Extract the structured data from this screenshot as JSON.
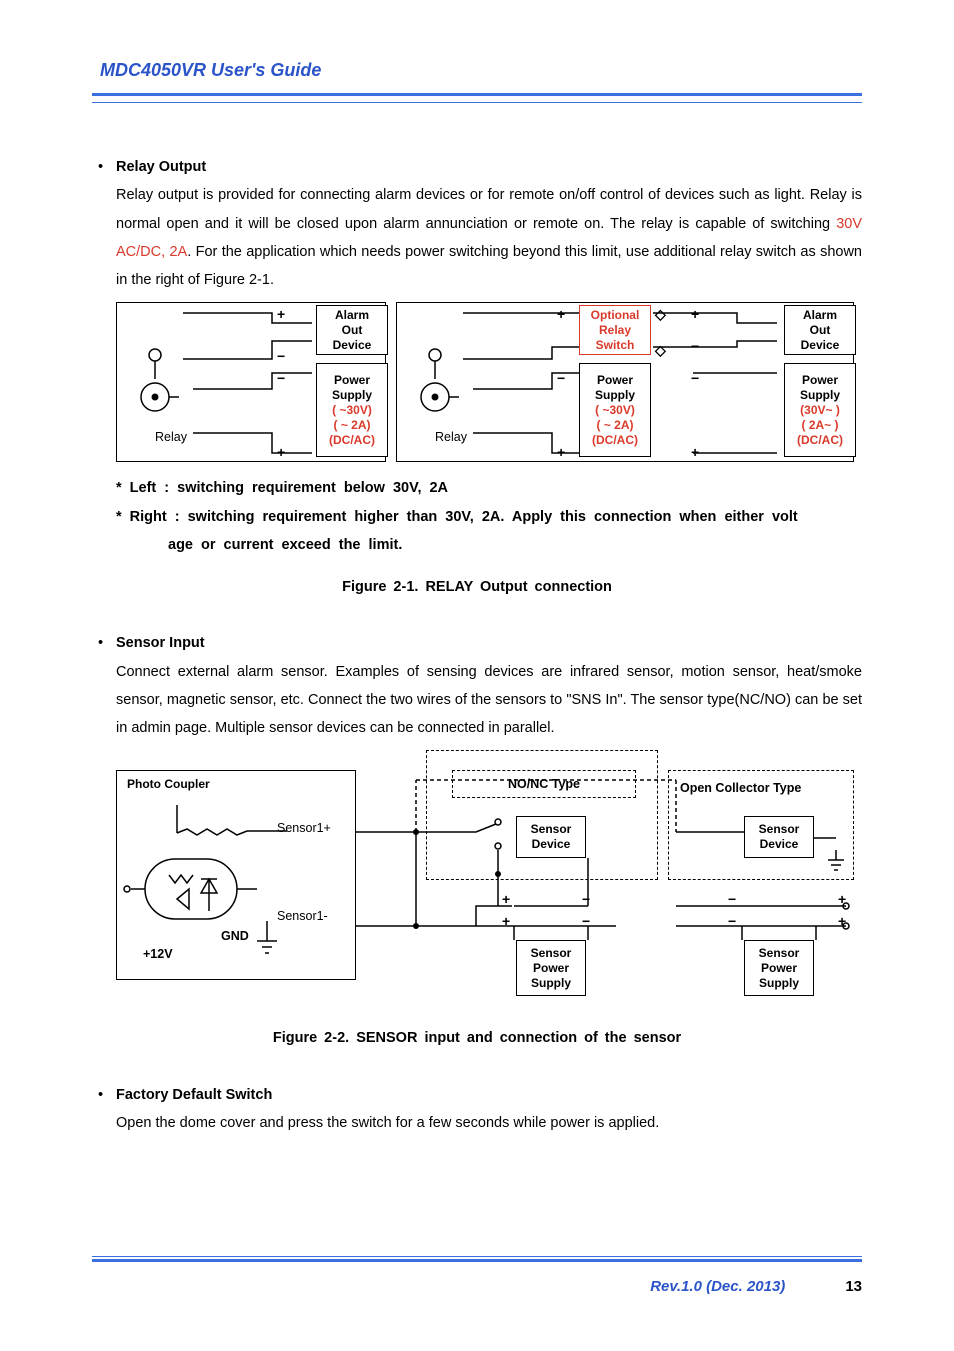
{
  "header": {
    "title": "MDC4050VR User's Guide"
  },
  "s1": {
    "title": "Relay Output",
    "p1a": "Relay output is provided for connecting alarm devices or for remote on/off control of devices such as light. Relay is normal open and it will be closed upon alarm annunciation or remote on.   The relay is capable of switching ",
    "p1red": "30V AC/DC, 2A",
    "p1b": ". For the application which needs power switching beyond this limit, use additional relay switch as shown in the right of Figure 2-1.",
    "note1": "*  Left : switching requirement below 30V, 2A",
    "note2a": "*  Right : switching requirement higher than 30V, 2A. Apply this connection when either volt",
    "note2b": "age or current exceed the limit.",
    "caption": "Figure 2-1. RELAY Output connection"
  },
  "s2": {
    "title": "Sensor Input",
    "p1": "Connect external alarm sensor. Examples of sensing devices are infrared sensor, motion sensor, heat/smoke sensor, magnetic sensor, etc.   Connect the two wires of the sensors to \"SNS In\". The sensor type(NC/NO) can be set in admin page. Multiple sensor devices can be connected in parallel.",
    "caption": "Figure 2-2. SENSOR input and connection of the sensor"
  },
  "s3": {
    "title": "Factory Default Switch",
    "p1": "Open the dome cover and press the switch for a few seconds while power is applied."
  },
  "diagram1": {
    "relay": "Relay",
    "alarm_out": "Alarm\nOut\nDevice",
    "optional_relay": "Optional\nRelay\nSwitch",
    "ps_lines": [
      "Power",
      "Supply",
      "( ~30V)",
      "( ~ 2A)",
      "(DC/AC)"
    ],
    "ps_lines_high": [
      "Power",
      "Supply",
      "(30V~  )",
      "( 2A~  )",
      "(DC/AC)"
    ]
  },
  "diagram2": {
    "photo": "Photo Coupler",
    "s1p": "Sensor1+",
    "s1m": "Sensor1-",
    "gnd": "GND",
    "v12": "+12V",
    "nonc": "NO/NC Type",
    "openc": "Open Collector Type",
    "sdev": "Sensor\nDevice",
    "sps": "Sensor\nPower\nSupply"
  },
  "footer": {
    "rev": "Rev.1.0 (Dec. 2013)",
    "page": "13"
  }
}
